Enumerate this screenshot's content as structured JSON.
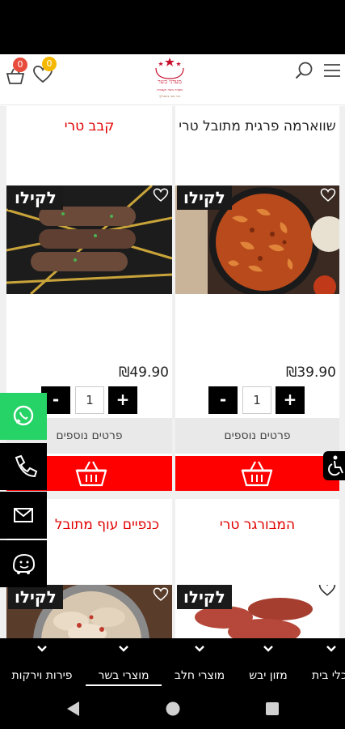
{
  "header": {
    "cart_count": "0",
    "wishlist_count": "0",
    "logo_name": "מעדני בשר",
    "logo_tagline": "מעדני בשר וקצביה",
    "logo_tagline2": "הכי טוב בשבילך"
  },
  "products": [
    {
      "title": "שווארמה פרגית מתובל טרי",
      "price": "₪39.90",
      "tag": "לקילו",
      "qty": "1",
      "more_label": "פרטים נוספים",
      "image_icon": "shawarma-image"
    },
    {
      "title": "קבב טרי",
      "price": "₪49.90",
      "tag": "לקילו",
      "qty": "1",
      "more_label": "פרטים נוספים",
      "image_icon": "kebab-image"
    },
    {
      "title": "המבורגר טרי",
      "tag": "לקילו",
      "image_icon": "hamburger-image"
    },
    {
      "title": "כנפיים עוף מתובל",
      "tag": "לקילו",
      "image_icon": "chicken-wings-image"
    }
  ],
  "bottom_nav": {
    "items": [
      {
        "label": "פירות וירקות",
        "active": false
      },
      {
        "label": "מוצרי בשר",
        "active": true
      },
      {
        "label": "מוצרי חלב",
        "active": false
      },
      {
        "label": "מזון יבש",
        "active": false
      },
      {
        "label": "כלי בית",
        "active": false
      }
    ]
  },
  "colors": {
    "accent_red": "#ff0000",
    "title_red": "#e00000",
    "whatsapp_green": "#25d366",
    "badge_red": "#e74c3c",
    "badge_yellow": "#f5b800"
  }
}
